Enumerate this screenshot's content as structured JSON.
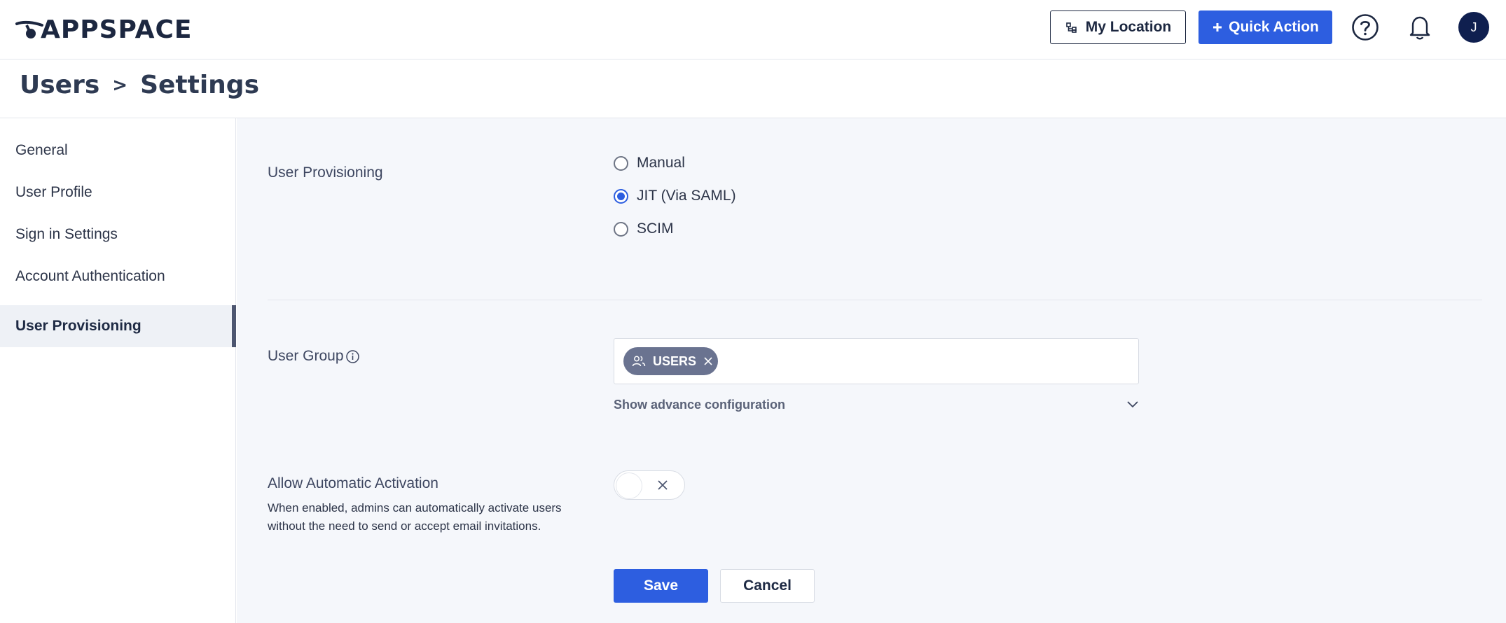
{
  "header": {
    "logo_text": "APPSPACE",
    "location_button": "My Location",
    "quick_action_button": "Quick Action",
    "avatar_initial": "J",
    "accent_color": "#2d5ee0",
    "icons": [
      "building-icon",
      "plus-icon",
      "help-icon",
      "bell-icon"
    ]
  },
  "breadcrumb": {
    "parent": "Users",
    "separator": ">",
    "current": "Settings"
  },
  "sidebar": {
    "items": [
      {
        "label": "General",
        "active": false
      },
      {
        "label": "User Profile",
        "active": false
      },
      {
        "label": "Sign in Settings",
        "active": false
      },
      {
        "label": "Account Authentication",
        "active": false
      },
      {
        "label": "User Provisioning",
        "active": true
      }
    ]
  },
  "provisioning": {
    "label": "User Provisioning",
    "options": [
      {
        "label": "Manual",
        "selected": false
      },
      {
        "label": "JIT (Via SAML)",
        "selected": true
      },
      {
        "label": "SCIM",
        "selected": false
      }
    ]
  },
  "user_group": {
    "label": "User Group",
    "chips": [
      {
        "label": "USERS"
      }
    ],
    "advanced_link": "Show advance configuration"
  },
  "auto_activation": {
    "label": "Allow Automatic Activation",
    "description": "When enabled, admins can automatically activate users without the need to send or accept email invitations.",
    "enabled": false
  },
  "actions": {
    "save": "Save",
    "cancel": "Cancel"
  }
}
